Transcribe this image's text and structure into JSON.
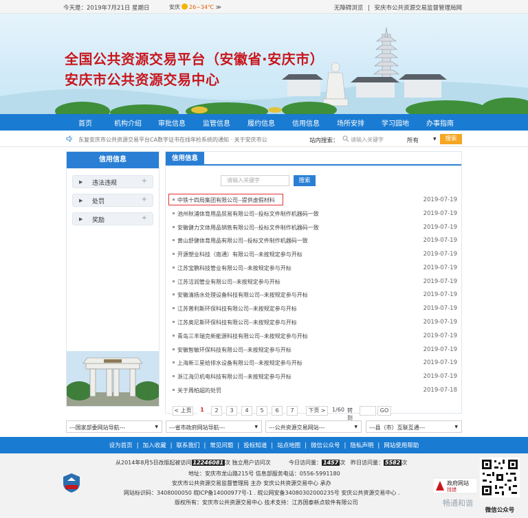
{
  "topbar": {
    "date": "今天是：2019年7月21日 星期日",
    "city": "安庆",
    "temp": "26~34℃",
    "weather_more": "≫",
    "links": [
      "无障碍浏览",
      "安庆市公共资源交易监督管理局网"
    ],
    "divider": "|"
  },
  "banner": {
    "title1": "全国公共资源交易平台（安徽省·安庆市）",
    "title2": "安庆市公共资源交易中心"
  },
  "nav": {
    "items": [
      "首页",
      "机构介绍",
      "审批信息",
      "监管信息",
      "履约信息",
      "信用信息",
      "场所安排",
      "学习园地",
      "办事指南"
    ]
  },
  "notice": {
    "text": "东复安庆市公共资源交易平台CA数字证书在线年检系统的通知 · 关于安庆市公",
    "search_label": "站内搜索：",
    "search_placeholder": "请输入关键字",
    "select_value": "所有",
    "search_button": "搜索"
  },
  "sidebar": {
    "title": "信用信息",
    "items": [
      {
        "label": "违法违规",
        "icon": "arrow-right-icon"
      },
      {
        "label": "处罚",
        "icon": "arrow-right-icon"
      },
      {
        "label": "奖励",
        "icon": "arrow-right-icon"
      }
    ],
    "plus": "+",
    "arrow": "▶"
  },
  "main": {
    "tab": "信用信息",
    "keyword_placeholder": "请输入关键字",
    "search_button": "搜索",
    "rows": [
      {
        "title": "中铁十四局集团有限公司--提供虚假材料",
        "date": "2019-07-19"
      },
      {
        "title": "池州秋浦体育用品贸易有限公司--投标文件制作机器码一致",
        "date": "2019-07-19"
      },
      {
        "title": "安徽健力文体用品销售有限公司--投标文件制作机器码一致",
        "date": "2019-07-19"
      },
      {
        "title": "黄山舒健体育用品有限公司--投标文件制作机器码一致",
        "date": "2019-07-19"
      },
      {
        "title": "开源塑业科技（南通）有限公司--未按规定参与开标",
        "date": "2019-07-19"
      },
      {
        "title": "江苏宝鹏科技管业有限公司--未按规定参与开标",
        "date": "2019-07-19"
      },
      {
        "title": "江苏洁润管业有限公司--未按规定参与开标",
        "date": "2019-07-19"
      },
      {
        "title": "安徽清扬水处理设备科技有限公司--未按规定参与开标",
        "date": "2019-07-19"
      },
      {
        "title": "江苏普利斯环保科技有限公司--未按规定参与开标",
        "date": "2019-07-19"
      },
      {
        "title": "江苏奥尼斯环保科技有限公司--未按规定参与开标",
        "date": "2019-07-19"
      },
      {
        "title": "青岛三丰瑞克新能源科技有限公司--未按规定参与开标",
        "date": "2019-07-19"
      },
      {
        "title": "安徽智敏环保科技有限公司--未按规定参与开标",
        "date": "2019-07-19"
      },
      {
        "title": "上海新三星给排水设备有限公司--未按规定参与开标",
        "date": "2019-07-19"
      },
      {
        "title": "浙江海贝机电科技有限公司--未按规定参与开标",
        "date": "2019-07-19"
      },
      {
        "title": "关于周柏超的处罚",
        "date": "2019-07-18"
      }
    ],
    "pager": {
      "prev": "< 上页",
      "pages": [
        "1",
        "2",
        "3",
        "4",
        "5",
        "6",
        "7"
      ],
      "current": "1",
      "next": "下页 >",
      "total": "1/60",
      "goto_label": "转到",
      "go": "GO"
    }
  },
  "selects": [
    "---国家部委网站导航---",
    "---省市政府网站导航---",
    "---公共资源交易网站---",
    "---县（市）互联互通---"
  ],
  "select_arrow": "▼",
  "footnav": {
    "items": [
      "设为首页",
      "加入收藏",
      "联系我们",
      "常见问题",
      "投标知道",
      "站点地图",
      "微信公众号",
      "隐私声明",
      "网站使用帮助"
    ],
    "sep": "|"
  },
  "footer": {
    "visits_prefix": "从2014年8月5日改版起被访问",
    "visits_total": "12246081",
    "visits_suffix": "次 独立用户访问次",
    "today_label": "今日访问量：",
    "today": "1457",
    "today_unit": "次",
    "yesterday_label": "昨日访问量：",
    "yesterday": "5582",
    "yesterday_unit": "次",
    "address": "地址：安庆市龙山路215号 信息部服务电话：0556-5991180",
    "sponsor": "安庆市公共资源交易监督管理局 主办 安庆公共资源交易中心 承办",
    "icp": "网站标识码：3408000050 皖ICP备14000977号-1 . 皖公网安备34080302000235号 安庆公共资源交易中心 .",
    "copyright": "版权所有：安庆市公共资源交易中心 技术支持：江苏国泰新点软件有限公司",
    "badge_text": "党政机关",
    "gov_label": "政府网站",
    "gov_sub": "找错",
    "qr_caption": "微信公众号",
    "watermark": "畅通和谐"
  }
}
